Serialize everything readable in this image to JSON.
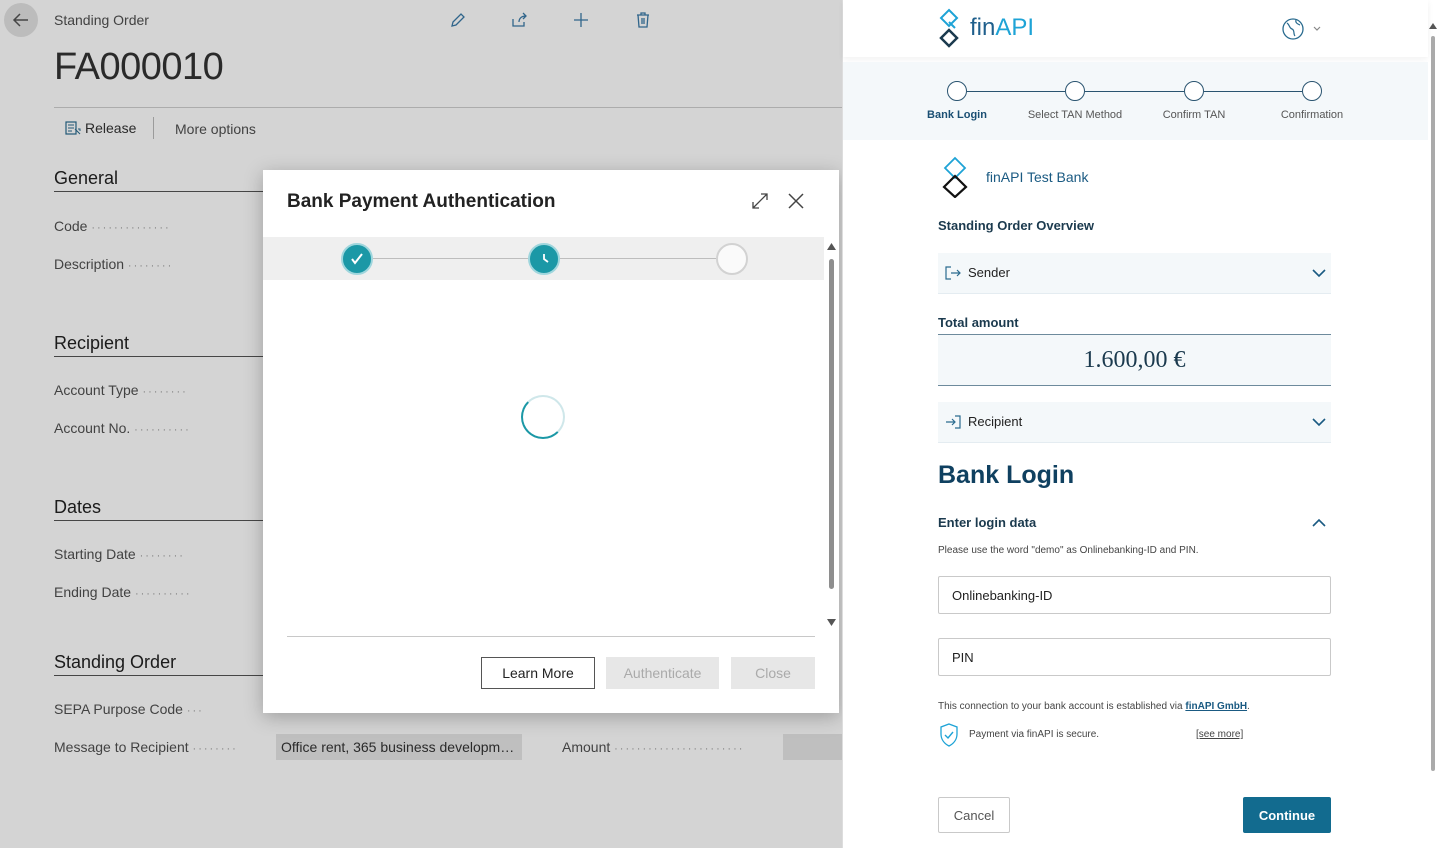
{
  "page": {
    "caption": "Standing Order",
    "title": "FA000010",
    "actions": {
      "release": "Release",
      "more": "More options"
    },
    "sections": {
      "general": "General",
      "recipient": "Recipient",
      "dates": "Dates",
      "standing_order": "Standing Order"
    },
    "fields": {
      "code": "Code",
      "description": "Description",
      "account_type": "Account Type",
      "account_no": "Account No.",
      "starting_date": "Starting Date",
      "ending_date": "Ending Date",
      "sepa_purpose_code": "SEPA Purpose Code",
      "message_to_recipient": "Message to Recipient",
      "message_value": "Office rent, 365 business developme...",
      "amount": "Amount"
    }
  },
  "modal": {
    "title": "Bank Payment Authentication",
    "buttons": {
      "learn_more": "Learn More",
      "authenticate": "Authenticate",
      "close": "Close"
    }
  },
  "finapi": {
    "logo": {
      "fin": "fin",
      "api": "API"
    },
    "steps": [
      "Bank Login",
      "Select TAN Method",
      "Confirm TAN",
      "Confirmation"
    ],
    "bank_name": "finAPI Test Bank",
    "overview_title": "Standing Order Overview",
    "sender_label": "Sender",
    "total_amount_label": "Total amount",
    "total_amount": "1.600,00 €",
    "recipient_label": "Recipient",
    "bank_login_title": "Bank Login",
    "login_section_title": "Enter login data",
    "login_hint": "Please use the word \"demo\" as Onlinebanking-ID and PIN.",
    "online_id_placeholder": "Onlinebanking-ID",
    "pin_placeholder": "PIN",
    "connection_text": "This connection to your bank account is established via ",
    "connection_link": "finAPI GmbH",
    "connection_suffix": ".",
    "secure_text": "Payment via finAPI is secure.",
    "see_more": "[see more]",
    "cancel": "Cancel",
    "continue": "Continue"
  },
  "colors": {
    "teal": "#1b98a6",
    "finapi_primary": "#126b8f",
    "finapi_dark": "#0f4060"
  }
}
